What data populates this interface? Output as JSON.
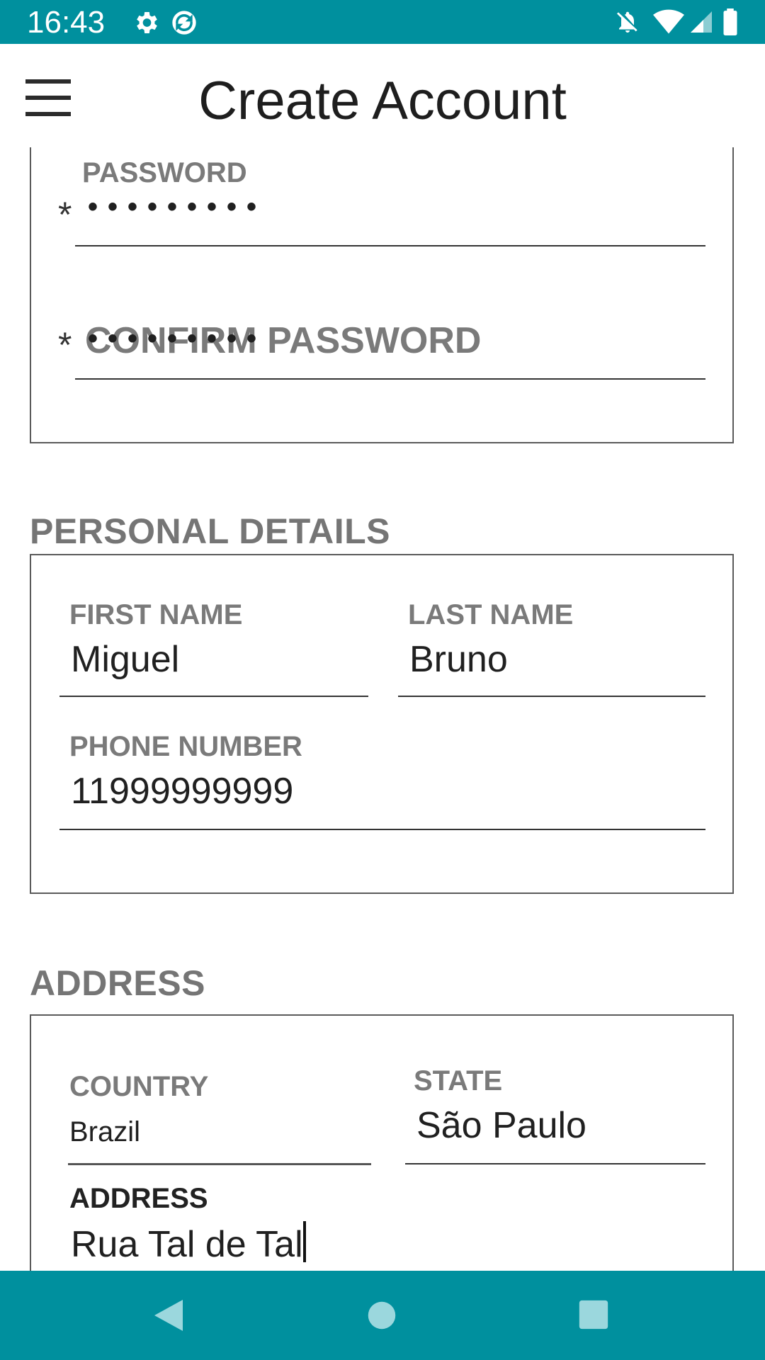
{
  "status_bar": {
    "time": "16:43",
    "left_icons": [
      "gear-icon",
      "sync-icon"
    ],
    "right_icons": [
      "notifications-off-icon",
      "wifi-icon",
      "signal-icon",
      "battery-icon"
    ]
  },
  "app_bar": {
    "title": "Create Account",
    "menu_icon": "hamburger-menu-icon"
  },
  "account_section": {
    "password": {
      "label": "PASSWORD",
      "required": "*",
      "value": "•••••••••"
    },
    "confirm_password": {
      "label": "CONFIRM PASSWORD",
      "required": "*",
      "value": "•••••••••"
    }
  },
  "personal_details": {
    "title": "PERSONAL DETAILS",
    "first_name": {
      "label": "FIRST NAME",
      "value": "Miguel"
    },
    "last_name": {
      "label": "LAST NAME",
      "value": "Bruno"
    },
    "phone_number": {
      "label": "PHONE NUMBER",
      "value": "11999999999"
    }
  },
  "address_section": {
    "title": "ADDRESS",
    "country": {
      "label": "COUNTRY",
      "value": "Brazil"
    },
    "state": {
      "label": "STATE",
      "value": "São Paulo"
    },
    "address": {
      "label": "ADDRESS",
      "value": "Rua Tal de Tal"
    }
  },
  "nav_bar": {
    "buttons": [
      "back-icon",
      "home-icon",
      "recents-icon"
    ]
  },
  "colors": {
    "accent": "#00909e",
    "label_gray": "#7a7a7a",
    "text": "#202020"
  }
}
